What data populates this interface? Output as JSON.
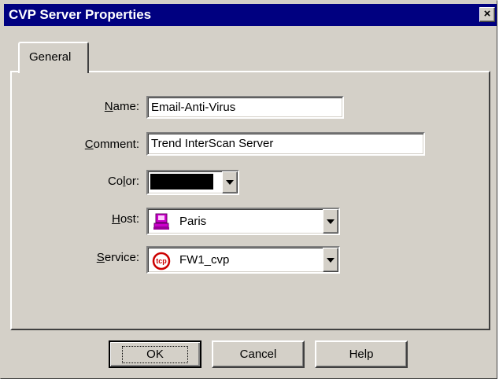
{
  "window": {
    "title": "CVP Server Properties",
    "close_label": "×"
  },
  "tabs": [
    {
      "label": "General"
    }
  ],
  "form": {
    "name": {
      "label_key": "N",
      "label_rest": "ame:",
      "value": "Email-Anti-Virus"
    },
    "comment": {
      "label_key": "C",
      "label_rest": "omment:",
      "value": "Trend InterScan Server"
    },
    "color": {
      "label_pre": "Co",
      "label_key": "l",
      "label_rest": "or:",
      "value_color": "#000000"
    },
    "host": {
      "label_key": "H",
      "label_rest": "ost:",
      "value": "Paris",
      "icon": "host-computer-icon"
    },
    "service": {
      "label_key": "S",
      "label_rest": "ervice:",
      "value": "FW1_cvp",
      "icon": "tcp-service-icon"
    }
  },
  "buttons": {
    "ok": "OK",
    "cancel": "Cancel",
    "help": "Help"
  },
  "colors": {
    "title_bar": "#000080",
    "face": "#d4d0c8",
    "host_icon": "#cc00cc",
    "service_icon": "#cc0000"
  }
}
